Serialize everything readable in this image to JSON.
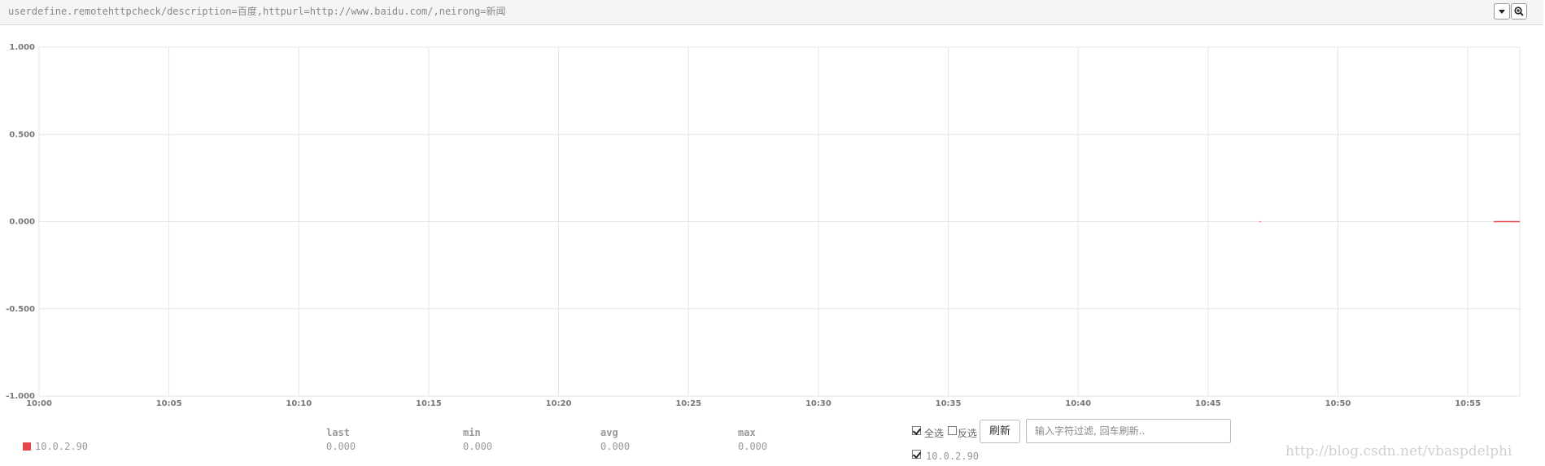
{
  "header": {
    "title": "userdefine.remotehttpcheck/description=百度,httpurl=http://www.baidu.com/,neirong=新闻",
    "dropdown_icon": "caret-down-icon",
    "zoom_icon": "zoom-in-icon"
  },
  "chart_data": {
    "type": "line",
    "ylim": [
      -1.0,
      1.0
    ],
    "y_ticks": [
      "1.000",
      "0.500",
      "0.000",
      "-0.500",
      "-1.000"
    ],
    "x_ticks": [
      "10:00",
      "10:05",
      "10:10",
      "10:15",
      "10:20",
      "10:25",
      "10:30",
      "10:35",
      "10:40",
      "10:45",
      "10:50",
      "10:55"
    ],
    "xlim": [
      "10:00",
      "10:57"
    ],
    "grid": true,
    "series": [
      {
        "name": "10.0.2.90",
        "color": "#e8474c",
        "points": [
          [
            "10:47",
            0.0
          ],
          [
            "10:56",
            0.0
          ],
          [
            "10:57",
            0.0
          ]
        ]
      }
    ]
  },
  "legend": {
    "series_name": "10.0.2.90",
    "series_color": "#e8474c",
    "headers": [
      "last",
      "min",
      "avg",
      "max"
    ],
    "values": [
      "0.000",
      "0.000",
      "0.000",
      "0.000"
    ]
  },
  "controls": {
    "select_all_label": "全选",
    "invert_label": "反选",
    "refresh_label": "刷新",
    "filter_placeholder": "输入字符过滤, 回车刷新..",
    "host_label": "10.0.2.90"
  },
  "watermark": "http://blog.csdn.net/vbaspdelphi"
}
